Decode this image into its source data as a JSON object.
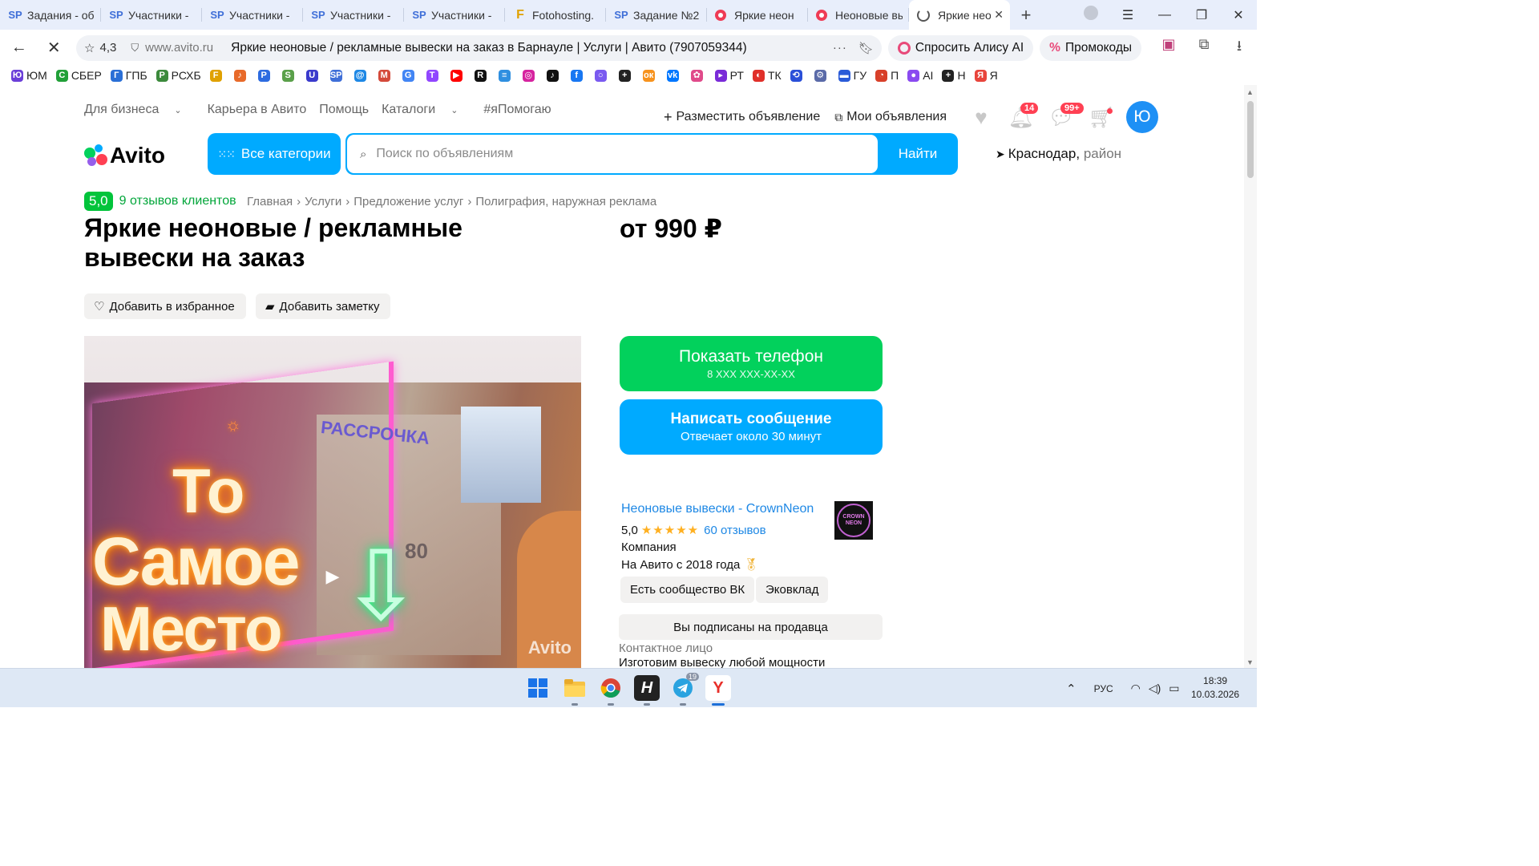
{
  "browser": {
    "tabs": [
      {
        "icon": "SP",
        "title": "Задания - об"
      },
      {
        "icon": "SP",
        "title": "Участники - "
      },
      {
        "icon": "SP",
        "title": "Участники - "
      },
      {
        "icon": "SP",
        "title": "Участники - "
      },
      {
        "icon": "SP",
        "title": "Участники - "
      },
      {
        "icon": "F",
        "title": "Fotohosting."
      },
      {
        "icon": "SP",
        "title": "Задание №2"
      },
      {
        "icon": "red-dot",
        "title": "Яркие неон"
      },
      {
        "icon": "red-dot",
        "title": "Неоновые вы"
      },
      {
        "icon": "spinner",
        "title": "Яркие нео",
        "active": true
      }
    ],
    "address": {
      "site_rating": "4,3",
      "domain": "www.avito.ru",
      "page_title": "Яркие неоновые / рекламные вывески на заказ в Барнауле | Услуги | Авито (7907059344)"
    },
    "alice_label": "Спросить Алису AI",
    "promo_label": "Промокоды",
    "bookmarks": [
      {
        "label": "ЮМ",
        "color": "#6b3fd8",
        "glyph": "Ю"
      },
      {
        "label": "СБЕР",
        "color": "#21a038",
        "glyph": "С"
      },
      {
        "label": "ГПБ",
        "color": "#2a6fd6",
        "glyph": "Г"
      },
      {
        "label": "РСХБ",
        "color": "#3c8a3c",
        "glyph": "Р"
      },
      {
        "label": "",
        "color": "#e0a100",
        "glyph": "F"
      },
      {
        "label": "",
        "color": "#e86a2a",
        "glyph": "♪"
      },
      {
        "label": "",
        "color": "#2d6be0",
        "glyph": "P"
      },
      {
        "label": "",
        "color": "#5aa04a",
        "glyph": "S"
      },
      {
        "label": "",
        "color": "#3a3acc",
        "glyph": "U"
      },
      {
        "label": "",
        "color": "#3f6fd8",
        "glyph": "SP"
      },
      {
        "label": "",
        "color": "#1e88e5",
        "glyph": "@"
      },
      {
        "label": "",
        "color": "#d44a3a",
        "glyph": "M"
      },
      {
        "label": "",
        "color": "#4285f4",
        "glyph": "G"
      },
      {
        "label": "",
        "color": "#9146ff",
        "glyph": "T"
      },
      {
        "label": "",
        "color": "#ff0000",
        "glyph": "▶"
      },
      {
        "label": "",
        "color": "#111111",
        "glyph": "R"
      },
      {
        "label": "",
        "color": "#2f8fe0",
        "glyph": "≡"
      },
      {
        "label": "",
        "color": "#d6249f",
        "glyph": "◎"
      },
      {
        "label": "",
        "color": "#111111",
        "glyph": "♪"
      },
      {
        "label": "",
        "color": "#1877f2",
        "glyph": "f"
      },
      {
        "label": "",
        "color": "#7a5af0",
        "glyph": "○"
      },
      {
        "label": "",
        "color": "#222222",
        "glyph": "+"
      },
      {
        "label": "",
        "color": "#f7931e",
        "glyph": "ок"
      },
      {
        "label": "",
        "color": "#0077ff",
        "glyph": "vk"
      },
      {
        "label": "",
        "color": "#e04a8a",
        "glyph": "✿"
      },
      {
        "label": "РТ",
        "color": "#7a2bd8",
        "glyph": "▸"
      },
      {
        "label": "ТК",
        "color": "#e0302a",
        "glyph": "◐"
      },
      {
        "label": "",
        "color": "#2a4fd8",
        "glyph": "⟲"
      },
      {
        "label": "",
        "color": "#5a6aa8",
        "glyph": "⚙"
      },
      {
        "label": "ГУ",
        "color": "#2a5bd8",
        "glyph": "▬"
      },
      {
        "label": "П",
        "color": "#d8402a",
        "glyph": "◔"
      },
      {
        "label": "AI",
        "color": "#8a4af0",
        "glyph": "●"
      },
      {
        "label": "Н",
        "color": "#222222",
        "glyph": "+"
      },
      {
        "label": "Я",
        "color": "#e8453c",
        "glyph": "Я"
      }
    ]
  },
  "site": {
    "topnav": {
      "business": "Для бизнеса",
      "career": "Карьера в Авито",
      "help": "Помощь",
      "catalogs": "Каталоги",
      "ihelp": "#яПомогаю"
    },
    "post_ad": "Разместить объявление",
    "my_ads": "Мои объявления",
    "notifications_count": "14",
    "messages_count": "99+",
    "avatar_letter": "Ю",
    "logo_text": "Avito",
    "all_categories": "Все категории",
    "search_placeholder": "Поиск по объявлениям",
    "search_button": "Найти",
    "location_city": "Краснодар,",
    "location_region": "район",
    "brand_colors": {
      "green": "#02d15c",
      "blue": "#00aaff",
      "red": "#ff4053",
      "purple": "#965eeb"
    }
  },
  "listing": {
    "rating_score": "5,0",
    "reviews_link": "9 отзывов клиентов",
    "breadcrumbs": [
      "Главная",
      "Услуги",
      "Предложение услуг",
      "Полиграфия, наружная реклама"
    ],
    "title": "Яркие неоновые / рекламные вывески на заказ",
    "price": "от 990 ₽",
    "add_favorite": "Добавить в избранное",
    "add_note": "Добавить заметку",
    "photo_neon_text": [
      "То",
      "Самое",
      "Место"
    ],
    "photo_sign_text": "РАССРОЧКА",
    "photo_watermark": "Avito",
    "show_phone": "Показать телефон",
    "phone_mask": "8 XXX XXX-XX-XX",
    "write_message": "Написать сообщение",
    "reply_time": "Отвечает около 30 минут"
  },
  "seller": {
    "name": "Неоновые вывески - CrownNeon",
    "rating": "5,0",
    "stars": "★★★★★",
    "reviews": "60 отзывов",
    "type": "Компания",
    "since": "На Авито с 2018 года",
    "logo_text": "CROWN NEON",
    "chips": [
      "Есть сообщество ВК",
      "Эковклад"
    ],
    "subscribed": "Вы подписаны на продавца",
    "contact_label": "Контактное лицо",
    "contact_name": "Изготовим вывеску любой мощности"
  },
  "taskbar": {
    "telegram_badge": "19",
    "lang": "РУС",
    "time": "18:39",
    "date": "10.03.2026"
  }
}
